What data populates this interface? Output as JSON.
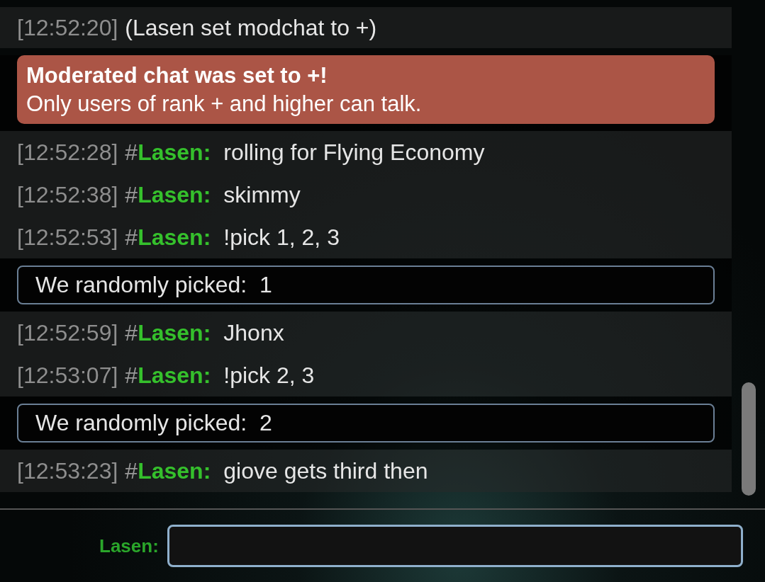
{
  "messages": [
    {
      "kind": "raw",
      "time": "[12:52:20]",
      "text": "(Lasen set modchat to +)"
    },
    {
      "kind": "error",
      "title": "Moderated chat was set to +!",
      "text": "Only users of rank + and higher can talk."
    },
    {
      "kind": "chat",
      "time": "[12:52:28]",
      "rank": "#",
      "user": "Lasen:",
      "color": "#35c02c",
      "text": "rolling for Flying Economy"
    },
    {
      "kind": "chat",
      "time": "[12:52:38]",
      "rank": "#",
      "user": "Lasen:",
      "color": "#35c02c",
      "text": "skimmy"
    },
    {
      "kind": "chat",
      "time": "[12:52:53]",
      "rank": "#",
      "user": "Lasen:",
      "color": "#35c02c",
      "text": "!pick 1, 2, 3"
    },
    {
      "kind": "pick",
      "text": "We randomly picked:  1"
    },
    {
      "kind": "chat",
      "time": "[12:52:59]",
      "rank": "#",
      "user": "Lasen:",
      "color": "#35c02c",
      "text": "Jhonx"
    },
    {
      "kind": "chat",
      "time": "[12:53:07]",
      "rank": "#",
      "user": "Lasen:",
      "color": "#35c02c",
      "text": "!pick 2, 3"
    },
    {
      "kind": "pick",
      "text": "We randomly picked:  2"
    },
    {
      "kind": "chat",
      "time": "[12:53:23]",
      "rank": "#",
      "user": "Lasen:",
      "color": "#35c02c",
      "text": "giove gets third then"
    }
  ],
  "compose": {
    "user": "Lasen:",
    "color": "#2aa52a"
  }
}
